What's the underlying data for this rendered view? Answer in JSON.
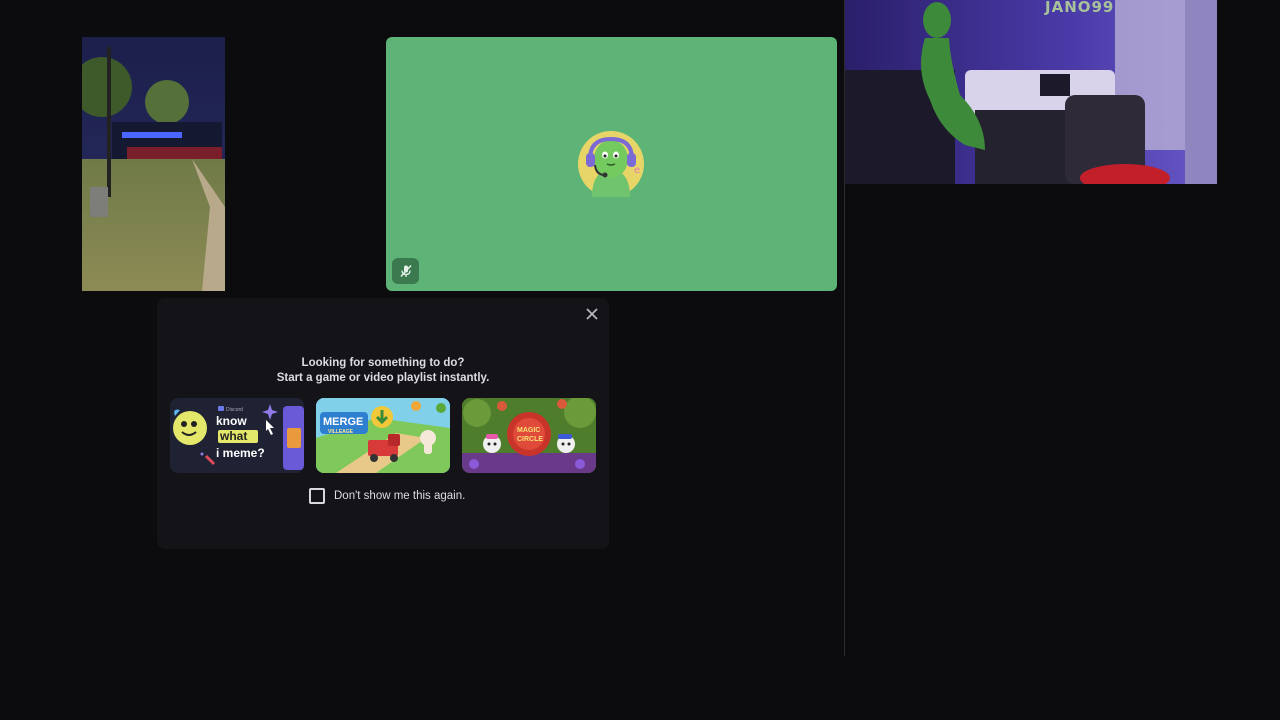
{
  "tiles": {
    "right_camera_text": "JANO99"
  },
  "popup": {
    "line1": "Looking for something to do?",
    "line2": "Start a game or video playlist instantly.",
    "games": [
      {
        "name": "Know What I Meme",
        "logo_text": "Discord",
        "words": [
          "know",
          "what",
          "i meme?"
        ]
      },
      {
        "name": "Merge Villeage",
        "logo_text": "MERGE",
        "logo_sub": "VILLEAGE"
      },
      {
        "name": "Magic Circle",
        "logo_text": "MAGIC",
        "logo_sub": "CIRCLE"
      }
    ],
    "checkbox_label": "Don't show me this again.",
    "checkbox_checked": false
  },
  "colors": {
    "background": "#0c0c0e",
    "avatar_tile": "#5db476",
    "popup": "#141418"
  }
}
